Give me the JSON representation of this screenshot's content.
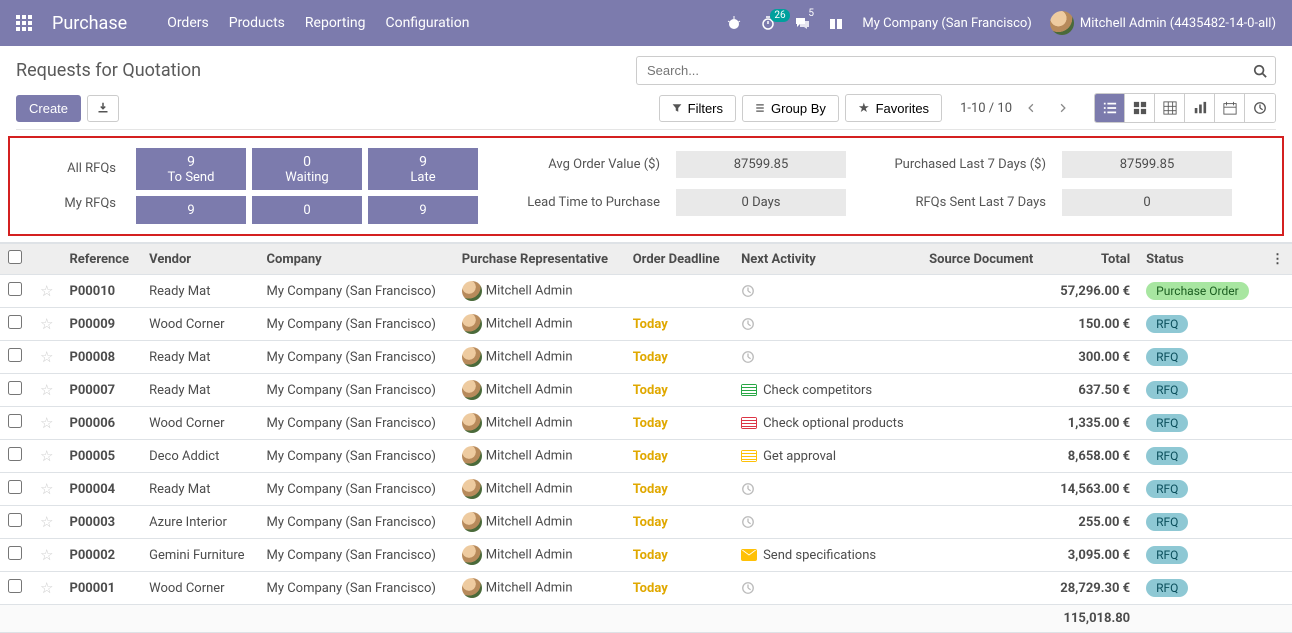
{
  "nav": {
    "brand": "Purchase",
    "menu": [
      "Orders",
      "Products",
      "Reporting",
      "Configuration"
    ],
    "badge1": "26",
    "badge2": "5",
    "company": "My Company (San Francisco)",
    "user": "Mitchell Admin (4435482-14-0-all)"
  },
  "cp": {
    "title": "Requests for Quotation",
    "create": "Create",
    "search_placeholder": "Search...",
    "filters": "Filters",
    "groupby": "Group By",
    "favorites": "Favorites",
    "pager": "1-10 / 10"
  },
  "dash": {
    "rows": [
      "All RFQs",
      "My RFQs"
    ],
    "tiles_top": [
      {
        "num": "9",
        "lbl": "To Send"
      },
      {
        "num": "0",
        "lbl": "Waiting"
      },
      {
        "num": "9",
        "lbl": "Late"
      }
    ],
    "tiles_bottom": [
      "9",
      "0",
      "9"
    ],
    "stats": {
      "avg_label": "Avg Order Value ($)",
      "avg_value": "87599.85",
      "lead_label": "Lead Time to Purchase",
      "lead_value": "0  Days",
      "purch7_label": "Purchased Last 7 Days ($)",
      "purch7_value": "87599.85",
      "sent7_label": "RFQs Sent Last 7 Days",
      "sent7_value": "0"
    }
  },
  "columns": [
    "Reference",
    "Vendor",
    "Company",
    "Purchase Representative",
    "Order Deadline",
    "Next Activity",
    "Source Document",
    "Total",
    "Status"
  ],
  "rows": [
    {
      "ref": "P00010",
      "vendor": "Ready Mat",
      "company": "My Company (San Francisco)",
      "rep": "Mitchell Admin",
      "deadline": "",
      "activity": {
        "type": "clock"
      },
      "source": "",
      "total": "57,296.00 €",
      "status": "Purchase Order",
      "status_class": "badge-po"
    },
    {
      "ref": "P00009",
      "vendor": "Wood Corner",
      "company": "My Company (San Francisco)",
      "rep": "Mitchell Admin",
      "deadline": "Today",
      "activity": {
        "type": "clock"
      },
      "source": "",
      "total": "150.00 €",
      "status": "RFQ",
      "status_class": "badge-rfq"
    },
    {
      "ref": "P00008",
      "vendor": "Ready Mat",
      "company": "My Company (San Francisco)",
      "rep": "Mitchell Admin",
      "deadline": "Today",
      "activity": {
        "type": "clock"
      },
      "source": "",
      "total": "300.00 €",
      "status": "RFQ",
      "status_class": "badge-rfq"
    },
    {
      "ref": "P00007",
      "vendor": "Ready Mat",
      "company": "My Company (San Francisco)",
      "rep": "Mitchell Admin",
      "deadline": "Today",
      "activity": {
        "type": "task",
        "color": "ai-green",
        "text": "Check competitors"
      },
      "source": "",
      "total": "637.50 €",
      "status": "RFQ",
      "status_class": "badge-rfq"
    },
    {
      "ref": "P00006",
      "vendor": "Wood Corner",
      "company": "My Company (San Francisco)",
      "rep": "Mitchell Admin",
      "deadline": "Today",
      "activity": {
        "type": "task",
        "color": "ai-red",
        "text": "Check optional products"
      },
      "source": "",
      "total": "1,335.00 €",
      "status": "RFQ",
      "status_class": "badge-rfq"
    },
    {
      "ref": "P00005",
      "vendor": "Deco Addict",
      "company": "My Company (San Francisco)",
      "rep": "Mitchell Admin",
      "deadline": "Today",
      "activity": {
        "type": "task",
        "color": "ai-yellow",
        "text": "Get approval"
      },
      "source": "",
      "total": "8,658.00 €",
      "status": "RFQ",
      "status_class": "badge-rfq"
    },
    {
      "ref": "P00004",
      "vendor": "Ready Mat",
      "company": "My Company (San Francisco)",
      "rep": "Mitchell Admin",
      "deadline": "Today",
      "activity": {
        "type": "clock"
      },
      "source": "",
      "total": "14,563.00 €",
      "status": "RFQ",
      "status_class": "badge-rfq"
    },
    {
      "ref": "P00003",
      "vendor": "Azure Interior",
      "company": "My Company (San Francisco)",
      "rep": "Mitchell Admin",
      "deadline": "Today",
      "activity": {
        "type": "clock"
      },
      "source": "",
      "total": "255.00 €",
      "status": "RFQ",
      "status_class": "badge-rfq"
    },
    {
      "ref": "P00002",
      "vendor": "Gemini Furniture",
      "company": "My Company (San Francisco)",
      "rep": "Mitchell Admin",
      "deadline": "Today",
      "activity": {
        "type": "mail",
        "color": "ai-yellow",
        "text": "Send specifications"
      },
      "source": "",
      "total": "3,095.00 €",
      "status": "RFQ",
      "status_class": "badge-rfq"
    },
    {
      "ref": "P00001",
      "vendor": "Wood Corner",
      "company": "My Company (San Francisco)",
      "rep": "Mitchell Admin",
      "deadline": "Today",
      "activity": {
        "type": "clock"
      },
      "source": "",
      "total": "28,729.30 €",
      "status": "RFQ",
      "status_class": "badge-rfq"
    }
  ],
  "footer_total": "115,018.80"
}
